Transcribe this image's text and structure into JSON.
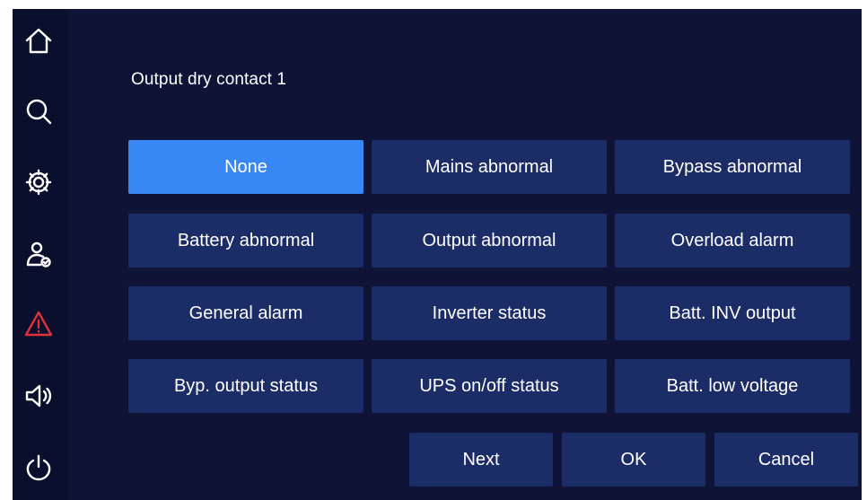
{
  "screen": {
    "title": "Output dry contact 1"
  },
  "sidebar": {
    "items": [
      {
        "icon": "home-icon"
      },
      {
        "icon": "search-icon"
      },
      {
        "icon": "settings-gear-icon"
      },
      {
        "icon": "user-check-icon"
      },
      {
        "icon": "warning-icon",
        "color": "#e0303a"
      },
      {
        "icon": "speaker-icon"
      },
      {
        "icon": "power-icon"
      }
    ]
  },
  "options": [
    {
      "label": "None",
      "selected": true
    },
    {
      "label": "Mains abnormal",
      "selected": false
    },
    {
      "label": "Bypass abnormal",
      "selected": false
    },
    {
      "label": "Battery abnormal",
      "selected": false
    },
    {
      "label": "Output abnormal",
      "selected": false
    },
    {
      "label": "Overload alarm",
      "selected": false
    },
    {
      "label": "General alarm",
      "selected": false
    },
    {
      "label": "Inverter status",
      "selected": false
    },
    {
      "label": "Batt. INV output",
      "selected": false
    },
    {
      "label": "Byp. output status",
      "selected": false
    },
    {
      "label": "UPS on/off status",
      "selected": false
    },
    {
      "label": "Batt. low voltage",
      "selected": false
    }
  ],
  "actions": {
    "next_label": "Next",
    "ok_label": "OK",
    "cancel_label": "Cancel"
  },
  "colors": {
    "background": "#0f1437",
    "sidebar": "#0a0f2e",
    "button": "#1c2c66",
    "selected": "#3787f4",
    "alert": "#e0303a"
  }
}
